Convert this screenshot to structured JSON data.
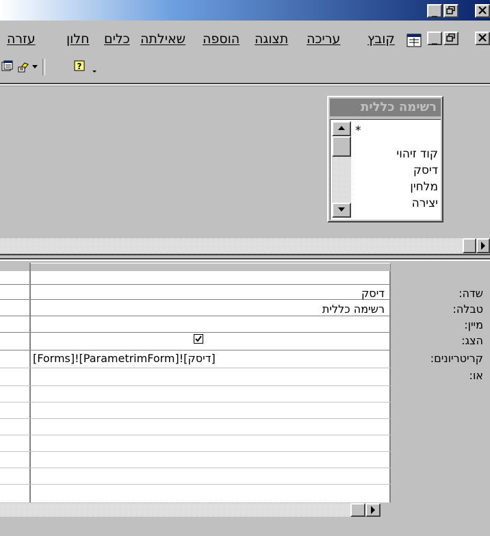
{
  "window": {
    "minimize_label": "_",
    "restore_label": "🗗",
    "close_label": "✕"
  },
  "menu": {
    "items": [
      "עזרה",
      "חלון",
      "כלים",
      "שאילתה",
      "הוספה",
      "תצוגה",
      "עריכה",
      "קובץ"
    ]
  },
  "field_list": {
    "title": "רשימה כללית",
    "items": [
      "*",
      "קוד זיהוי",
      "דיסק",
      "מלחין",
      "יצירה"
    ]
  },
  "grid": {
    "row_labels": [
      "שדה:",
      "טבלה:",
      "מיין:",
      "הצג:",
      "קריטריונים:",
      "או:"
    ],
    "field": "דיסק",
    "table": "רשימה כללית",
    "sort": "",
    "show": true,
    "criteria": "[Forms]![ParametrimForm]![דיסק]"
  }
}
